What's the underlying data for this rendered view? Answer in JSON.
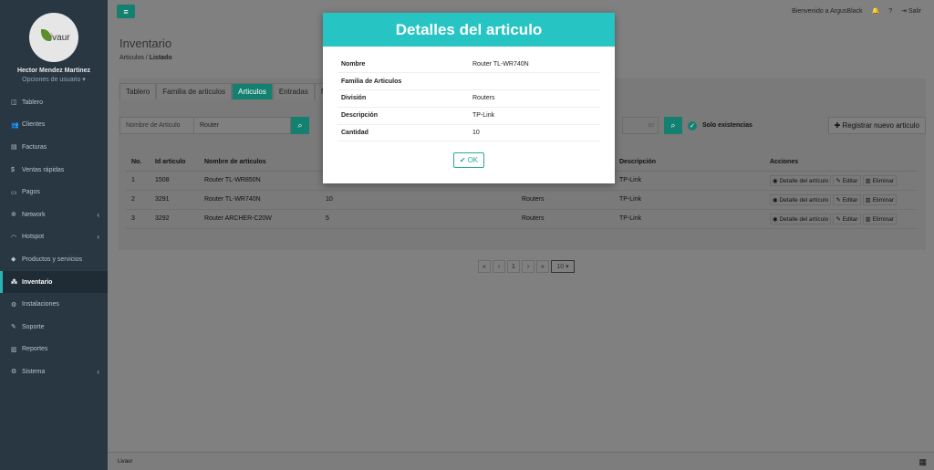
{
  "sidebar": {
    "brand": "Livaur",
    "user_name": "Hector Mendez Martinez",
    "user_options": "Opciones de usuario ▾",
    "items": [
      {
        "label": "Tablero",
        "icon": "dashboard-icon",
        "glyph": "◫"
      },
      {
        "label": "Clientes",
        "icon": "users-icon",
        "glyph": "👥"
      },
      {
        "label": "Facturas",
        "icon": "invoice-icon",
        "glyph": "▤"
      },
      {
        "label": "Ventas rápidas",
        "icon": "dollar-icon",
        "glyph": "$"
      },
      {
        "label": "Pagos",
        "icon": "money-icon",
        "glyph": "▭"
      },
      {
        "label": "Network",
        "icon": "network-icon",
        "glyph": "✲",
        "chevron": "‹"
      },
      {
        "label": "Hotspot",
        "icon": "wifi-icon",
        "glyph": "◠",
        "chevron": "‹"
      },
      {
        "label": "Productos y servicios",
        "icon": "tag-icon",
        "glyph": "◆"
      },
      {
        "label": "Inventario",
        "icon": "cubes-icon",
        "glyph": "⁂",
        "active": true
      },
      {
        "label": "Instalaciones",
        "icon": "wrench-list-icon",
        "glyph": "⚙"
      },
      {
        "label": "Soporte",
        "icon": "wrench-icon",
        "glyph": "✎"
      },
      {
        "label": "Reportes",
        "icon": "chart-icon",
        "glyph": "▥"
      },
      {
        "label": "Sistema",
        "icon": "cogs-icon",
        "glyph": "⚙",
        "chevron": "‹"
      }
    ]
  },
  "topbar": {
    "menu_glyph": "≡",
    "welcome": "Bienvenido a ArgusBlack",
    "bell_glyph": "🔔",
    "help_glyph": "?",
    "logout_glyph": "⇥",
    "logout": "Salir"
  },
  "page": {
    "title": "Inventario",
    "breadcrumb_parent": "Articulos",
    "breadcrumb_sep": "/",
    "breadcrumb_current": "Listado"
  },
  "tabs": [
    "Tablero",
    "Familia de articulos",
    "Articulos",
    "Entradas",
    "M"
  ],
  "search": {
    "label": "Nombre de Articulo",
    "value": "Router",
    "search_glyph": "⌕",
    "secondary_value": "ici",
    "check_glyph": "✓",
    "only_stock": "Solo existencias",
    "register_label": "✚ Registrar nuevo articulo"
  },
  "table": {
    "headers": {
      "no": "No.",
      "id": "Id articulo",
      "name": "Nombre de articulos",
      "desc": "Descripción",
      "actions": "Acciones"
    },
    "rows": [
      {
        "no": "1",
        "id": "1508",
        "name": "Router TL-WR850N",
        "qty": "",
        "division": "",
        "desc": "TP-Link"
      },
      {
        "no": "2",
        "id": "3291",
        "name": "Router TL-WR740N",
        "qty": "10",
        "division": "Routers",
        "desc": "TP-Link"
      },
      {
        "no": "3",
        "id": "3292",
        "name": "Router ARCHER-C20W",
        "qty": "5",
        "division": "Routers",
        "desc": "TP-Link"
      }
    ],
    "actions": {
      "detail": "◉ Detalle del artículo",
      "edit": "✎ Editar",
      "delete": "▥ Eliminar"
    }
  },
  "pager": {
    "first": "«",
    "prev": "‹",
    "page": "1",
    "next": "›",
    "last": "»",
    "page_size": "10",
    "size_glyph": "▾"
  },
  "footer": {
    "brand": "Livaur",
    "icon_glyph": "▦"
  },
  "modal": {
    "title": "Detalles del articulo",
    "fields": [
      {
        "label": "Nombre",
        "value": "Router TL-WR740N"
      },
      {
        "label": "Familia de Articulos",
        "value": ""
      },
      {
        "label": "División",
        "value": "Routers"
      },
      {
        "label": "Descripción",
        "value": "TP-Link"
      },
      {
        "label": "Cantidad",
        "value": "10"
      }
    ],
    "ok_glyph": "✔",
    "ok_label": "OK"
  },
  "colors": {
    "accent": "#14806f",
    "modal_header": "#27c4c4",
    "sidebar": "#283742"
  }
}
